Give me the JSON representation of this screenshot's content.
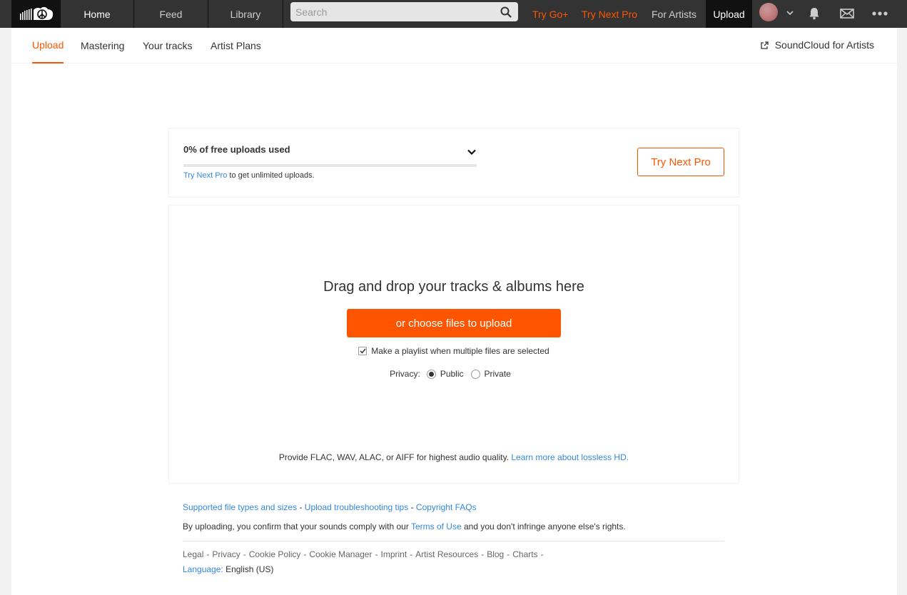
{
  "header": {
    "logo_icon": "soundcloud-logo-icon",
    "nav": {
      "home": "Home",
      "feed": "Feed",
      "library": "Library"
    },
    "search": {
      "placeholder": "Search",
      "value": ""
    },
    "links": {
      "try_go": "Try Go+",
      "try_next_pro": "Try Next Pro",
      "for_artists": "For Artists",
      "upload": "Upload"
    },
    "icons": [
      "avatar",
      "chevron-down-icon",
      "bell-icon",
      "mail-icon",
      "more-icon"
    ],
    "accent_color": "#ff5500"
  },
  "subnav": {
    "tabs": [
      {
        "label": "Upload",
        "active": true
      },
      {
        "label": "Mastering",
        "active": false
      },
      {
        "label": "Your tracks",
        "active": false
      },
      {
        "label": "Artist Plans",
        "active": false
      }
    ],
    "external_link": "SoundCloud for Artists"
  },
  "quota": {
    "label": "0% of free uploads used",
    "percent_used": 0,
    "note_link": "Try Next Pro",
    "note_text": " to get unlimited uploads.",
    "button": "Try Next Pro"
  },
  "dropzone": {
    "title": "Drag and drop your tracks & albums here",
    "choose_button": "or choose files to upload",
    "playlist_label": "Make a playlist when multiple files are selected",
    "playlist_checked": true,
    "privacy_label": "Privacy:",
    "privacy_options": [
      "Public",
      "Private"
    ],
    "privacy_selected": "Public",
    "quality_text": "Provide FLAC, WAV, ALAC, or AIFF for highest audio quality. ",
    "quality_link": "Learn more about lossless HD."
  },
  "footer": {
    "help_links": [
      "Supported file types and sizes",
      "Upload troubleshooting tips",
      "Copyright FAQs"
    ],
    "separator": "-",
    "consent_before": "By uploading, you confirm that your sounds comply with our ",
    "consent_link": "Terms of Use",
    "consent_after": " and you don't infringe anyone else's rights.",
    "legal_links": [
      "Legal",
      "Privacy",
      "Cookie Policy",
      "Cookie Manager",
      "Imprint",
      "Artist Resources",
      "Blog",
      "Charts"
    ],
    "language_label": "Language:",
    "language_value": "English (US)"
  }
}
